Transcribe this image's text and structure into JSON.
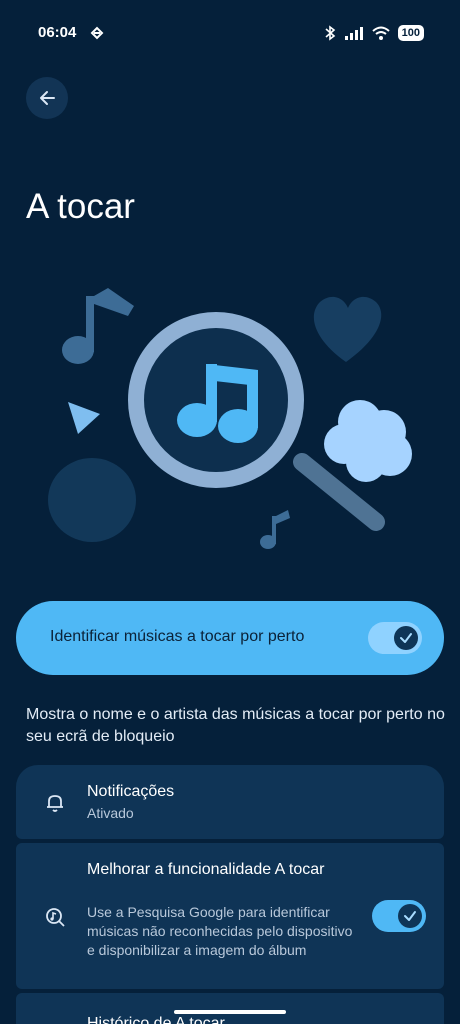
{
  "status_bar": {
    "time": "06:04",
    "battery": "100"
  },
  "header": {
    "back_icon": "arrow-left-icon",
    "title": "A tocar"
  },
  "main_toggle": {
    "label": "Identificar músicas a tocar por perto",
    "enabled": true
  },
  "description": "Mostra o nome e o artista das músicas a tocar por perto no seu ecrã de bloqueio",
  "settings": [
    {
      "icon": "bell-icon",
      "title": "Notificações",
      "subtitle": "Ativado"
    },
    {
      "icon": "music-search-icon",
      "title": "Melhorar a funcionalidade A tocar",
      "subtitle": "Use a Pesquisa Google para identificar músicas não reconhecidas pelo dispositivo e disponibilizar a imagem do álbum",
      "enabled": true
    },
    {
      "title": "Histórico de A tocar"
    }
  ],
  "colors": {
    "background": "#05203a",
    "accent": "#4fb8f5",
    "card": "#0f3456"
  }
}
